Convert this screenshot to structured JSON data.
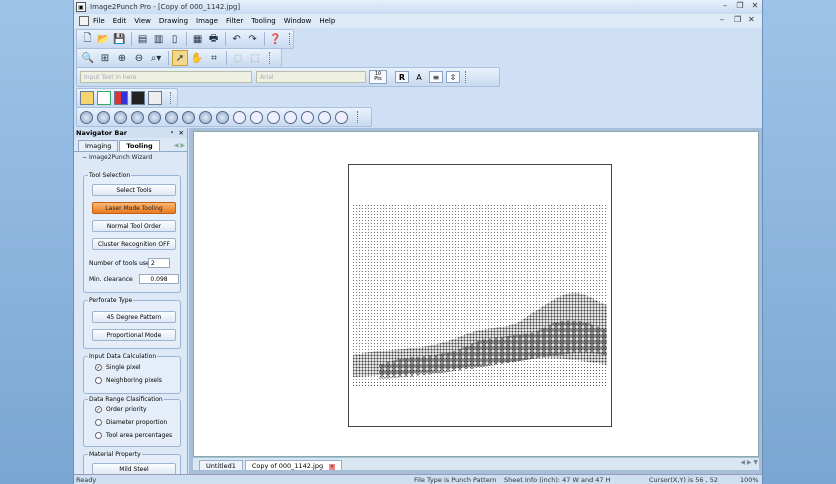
{
  "window": {
    "title": "Image2Punch Pro - [Copy of 000_1142.jpg]",
    "controls": [
      "–",
      "❐",
      "✕"
    ],
    "mdi_controls": [
      "–",
      "❐",
      "✕"
    ]
  },
  "menu": [
    "File",
    "Edit",
    "View",
    "Drawing",
    "Image",
    "Filter",
    "Tooling",
    "Window",
    "Help"
  ],
  "format_bar": {
    "text_placeholder": "Input Text in here",
    "font": "Arial",
    "size_value": "10",
    "size_unit": "Pts"
  },
  "navigator": {
    "title": "Navigator Bar",
    "pin": "ᵖ",
    "close": "✕",
    "tabs": [
      "Imaging",
      "Tooling"
    ],
    "active_tab": "Tooling",
    "wizard": "Image2Punch Wizard",
    "tool_selection": {
      "title": "Tool Selection",
      "buttons": [
        "Select Tools",
        "Laser Mode Tooling",
        "Normal Tool Order",
        "Cluster Recognition OFF"
      ],
      "num_tools_label": "Number of tools used",
      "num_tools_value": "2",
      "min_clearance_label": "Min. clearance",
      "min_clearance_value": "0.098"
    },
    "perforate": {
      "title": "Perforate Type",
      "buttons": [
        "45 Degree Pattern",
        "Proportional Mode"
      ]
    },
    "input_calc": {
      "title": "Input Data Calculation",
      "options": [
        "Single pixel",
        "Neighboring pixels"
      ],
      "selected": 0
    },
    "data_range": {
      "title": "Data Range Clasification",
      "options": [
        "Order priority",
        "Diameter proportion",
        "Tool area percentages"
      ],
      "selected": 0
    },
    "material": {
      "title": "Material Property",
      "button": "Mild Steel"
    }
  },
  "documents": {
    "tabs": [
      "Untitled1",
      "Copy of 000_1142.jpg"
    ],
    "active": 1
  },
  "status_bar": {
    "ready": "Ready",
    "file_type": "File Type is Punch Pattern",
    "sheet_info": "Sheet Info (inch): 47 W and 47 H",
    "cursor": "Cursor(X,Y) is 56 , 52",
    "zoom": "100%"
  }
}
